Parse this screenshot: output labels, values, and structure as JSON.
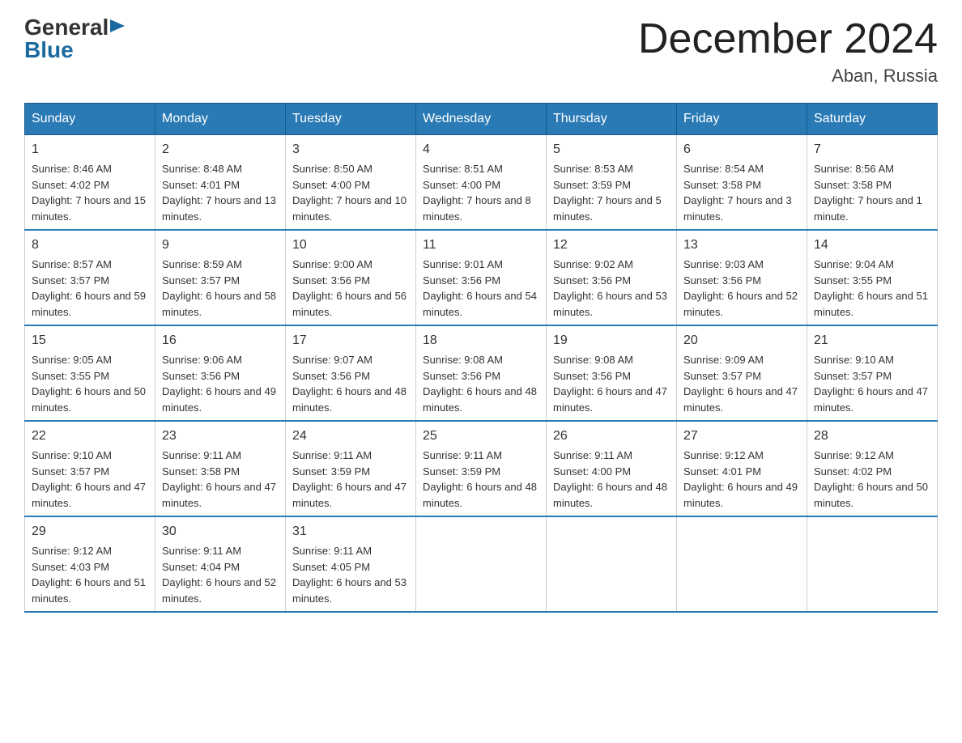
{
  "logo": {
    "general": "General",
    "blue": "Blue"
  },
  "title": "December 2024",
  "subtitle": "Aban, Russia",
  "days": [
    "Sunday",
    "Monday",
    "Tuesday",
    "Wednesday",
    "Thursday",
    "Friday",
    "Saturday"
  ],
  "weeks": [
    [
      {
        "num": "1",
        "sunrise": "8:46 AM",
        "sunset": "4:02 PM",
        "daylight": "7 hours and 15 minutes."
      },
      {
        "num": "2",
        "sunrise": "8:48 AM",
        "sunset": "4:01 PM",
        "daylight": "7 hours and 13 minutes."
      },
      {
        "num": "3",
        "sunrise": "8:50 AM",
        "sunset": "4:00 PM",
        "daylight": "7 hours and 10 minutes."
      },
      {
        "num": "4",
        "sunrise": "8:51 AM",
        "sunset": "4:00 PM",
        "daylight": "7 hours and 8 minutes."
      },
      {
        "num": "5",
        "sunrise": "8:53 AM",
        "sunset": "3:59 PM",
        "daylight": "7 hours and 5 minutes."
      },
      {
        "num": "6",
        "sunrise": "8:54 AM",
        "sunset": "3:58 PM",
        "daylight": "7 hours and 3 minutes."
      },
      {
        "num": "7",
        "sunrise": "8:56 AM",
        "sunset": "3:58 PM",
        "daylight": "7 hours and 1 minute."
      }
    ],
    [
      {
        "num": "8",
        "sunrise": "8:57 AM",
        "sunset": "3:57 PM",
        "daylight": "6 hours and 59 minutes."
      },
      {
        "num": "9",
        "sunrise": "8:59 AM",
        "sunset": "3:57 PM",
        "daylight": "6 hours and 58 minutes."
      },
      {
        "num": "10",
        "sunrise": "9:00 AM",
        "sunset": "3:56 PM",
        "daylight": "6 hours and 56 minutes."
      },
      {
        "num": "11",
        "sunrise": "9:01 AM",
        "sunset": "3:56 PM",
        "daylight": "6 hours and 54 minutes."
      },
      {
        "num": "12",
        "sunrise": "9:02 AM",
        "sunset": "3:56 PM",
        "daylight": "6 hours and 53 minutes."
      },
      {
        "num": "13",
        "sunrise": "9:03 AM",
        "sunset": "3:56 PM",
        "daylight": "6 hours and 52 minutes."
      },
      {
        "num": "14",
        "sunrise": "9:04 AM",
        "sunset": "3:55 PM",
        "daylight": "6 hours and 51 minutes."
      }
    ],
    [
      {
        "num": "15",
        "sunrise": "9:05 AM",
        "sunset": "3:55 PM",
        "daylight": "6 hours and 50 minutes."
      },
      {
        "num": "16",
        "sunrise": "9:06 AM",
        "sunset": "3:56 PM",
        "daylight": "6 hours and 49 minutes."
      },
      {
        "num": "17",
        "sunrise": "9:07 AM",
        "sunset": "3:56 PM",
        "daylight": "6 hours and 48 minutes."
      },
      {
        "num": "18",
        "sunrise": "9:08 AM",
        "sunset": "3:56 PM",
        "daylight": "6 hours and 48 minutes."
      },
      {
        "num": "19",
        "sunrise": "9:08 AM",
        "sunset": "3:56 PM",
        "daylight": "6 hours and 47 minutes."
      },
      {
        "num": "20",
        "sunrise": "9:09 AM",
        "sunset": "3:57 PM",
        "daylight": "6 hours and 47 minutes."
      },
      {
        "num": "21",
        "sunrise": "9:10 AM",
        "sunset": "3:57 PM",
        "daylight": "6 hours and 47 minutes."
      }
    ],
    [
      {
        "num": "22",
        "sunrise": "9:10 AM",
        "sunset": "3:57 PM",
        "daylight": "6 hours and 47 minutes."
      },
      {
        "num": "23",
        "sunrise": "9:11 AM",
        "sunset": "3:58 PM",
        "daylight": "6 hours and 47 minutes."
      },
      {
        "num": "24",
        "sunrise": "9:11 AM",
        "sunset": "3:59 PM",
        "daylight": "6 hours and 47 minutes."
      },
      {
        "num": "25",
        "sunrise": "9:11 AM",
        "sunset": "3:59 PM",
        "daylight": "6 hours and 48 minutes."
      },
      {
        "num": "26",
        "sunrise": "9:11 AM",
        "sunset": "4:00 PM",
        "daylight": "6 hours and 48 minutes."
      },
      {
        "num": "27",
        "sunrise": "9:12 AM",
        "sunset": "4:01 PM",
        "daylight": "6 hours and 49 minutes."
      },
      {
        "num": "28",
        "sunrise": "9:12 AM",
        "sunset": "4:02 PM",
        "daylight": "6 hours and 50 minutes."
      }
    ],
    [
      {
        "num": "29",
        "sunrise": "9:12 AM",
        "sunset": "4:03 PM",
        "daylight": "6 hours and 51 minutes."
      },
      {
        "num": "30",
        "sunrise": "9:11 AM",
        "sunset": "4:04 PM",
        "daylight": "6 hours and 52 minutes."
      },
      {
        "num": "31",
        "sunrise": "9:11 AM",
        "sunset": "4:05 PM",
        "daylight": "6 hours and 53 minutes."
      },
      null,
      null,
      null,
      null
    ]
  ]
}
